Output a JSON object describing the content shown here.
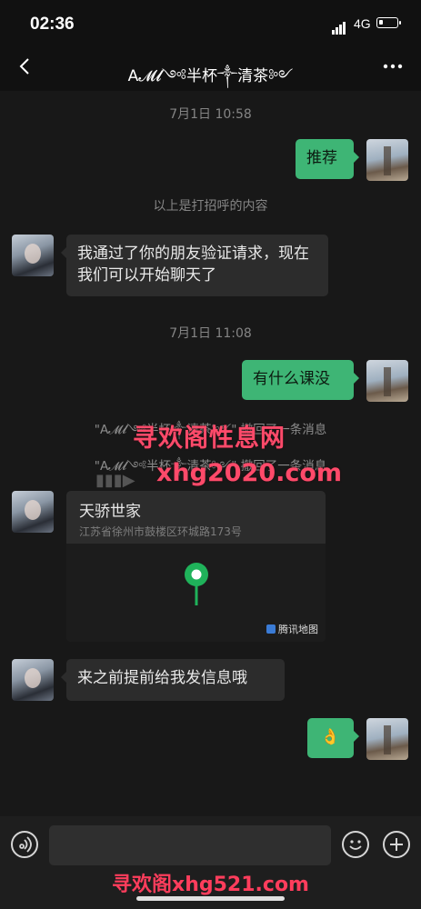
{
  "status": {
    "time": "02:36",
    "network": "4G"
  },
  "header": {
    "title": "A𝓜𝓵༺半杯༒清茶༻"
  },
  "messages": {
    "ts1": "7月1日 10:58",
    "m_tuijian": "推荐",
    "hint": "以上是打招呼的内容",
    "m_verified": "我通过了你的朋友验证请求，现在我们可以开始聊天了",
    "ts2": "7月1日 11:08",
    "m_course": "有什么课没",
    "recall1": "\"A𝓜𝓵༺半杯༒清茶༻\" 撤回了一条消息",
    "recall2": "\"A𝓜𝓵༺半杯༒清茶༻\" 撤回了一条消息",
    "loc_name": "天骄世家",
    "loc_addr": "江苏省徐州市鼓楼区环城路173号",
    "map_brand": "腾讯地图",
    "m_notice": "来之前提前给我发信息哦",
    "m_emoji": "👌"
  },
  "watermarks": {
    "w1": "寻欢阁性息网",
    "w2": "xhg2020.com",
    "w3": "寻欢阁xhg521.com"
  },
  "colors": {
    "bubble_out": "#3eb575",
    "bubble_in": "#2c2c2c",
    "pin": "#1fb25a"
  }
}
